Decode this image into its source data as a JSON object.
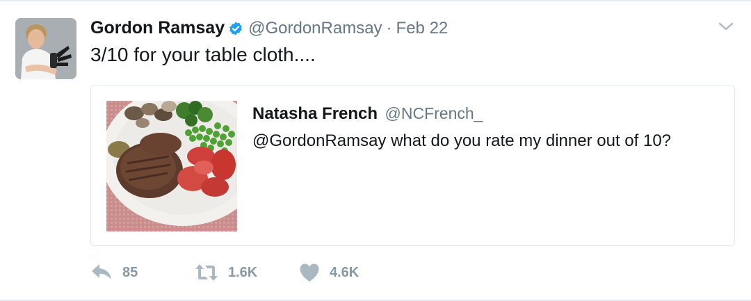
{
  "tweet": {
    "author_name": "Gordon Ramsay",
    "author_handle": "@GordonRamsay",
    "separator": "·",
    "date": "Feb 22",
    "text": "3/10 for your table cloth....",
    "verified": true
  },
  "quoted_tweet": {
    "author_name": "Natasha French",
    "author_handle": "@NCFrench_",
    "text": "@GordonRamsay what do you rate my dinner out of 10?",
    "media_description": "plate with steak, peas, broccoli, mushrooms and tomatoes"
  },
  "actions": {
    "replies": "85",
    "retweets": "1.6K",
    "likes": "4.6K"
  },
  "icons": {
    "verified": "verified-badge-icon",
    "menu": "chevron-down-icon",
    "reply": "reply-icon",
    "retweet": "retweet-icon",
    "like": "heart-icon"
  },
  "colors": {
    "text_primary": "#14171a",
    "text_secondary": "#657786",
    "action_gray": "#8899a6",
    "verified_blue": "#1da1f2",
    "border": "#e1e8ed"
  }
}
